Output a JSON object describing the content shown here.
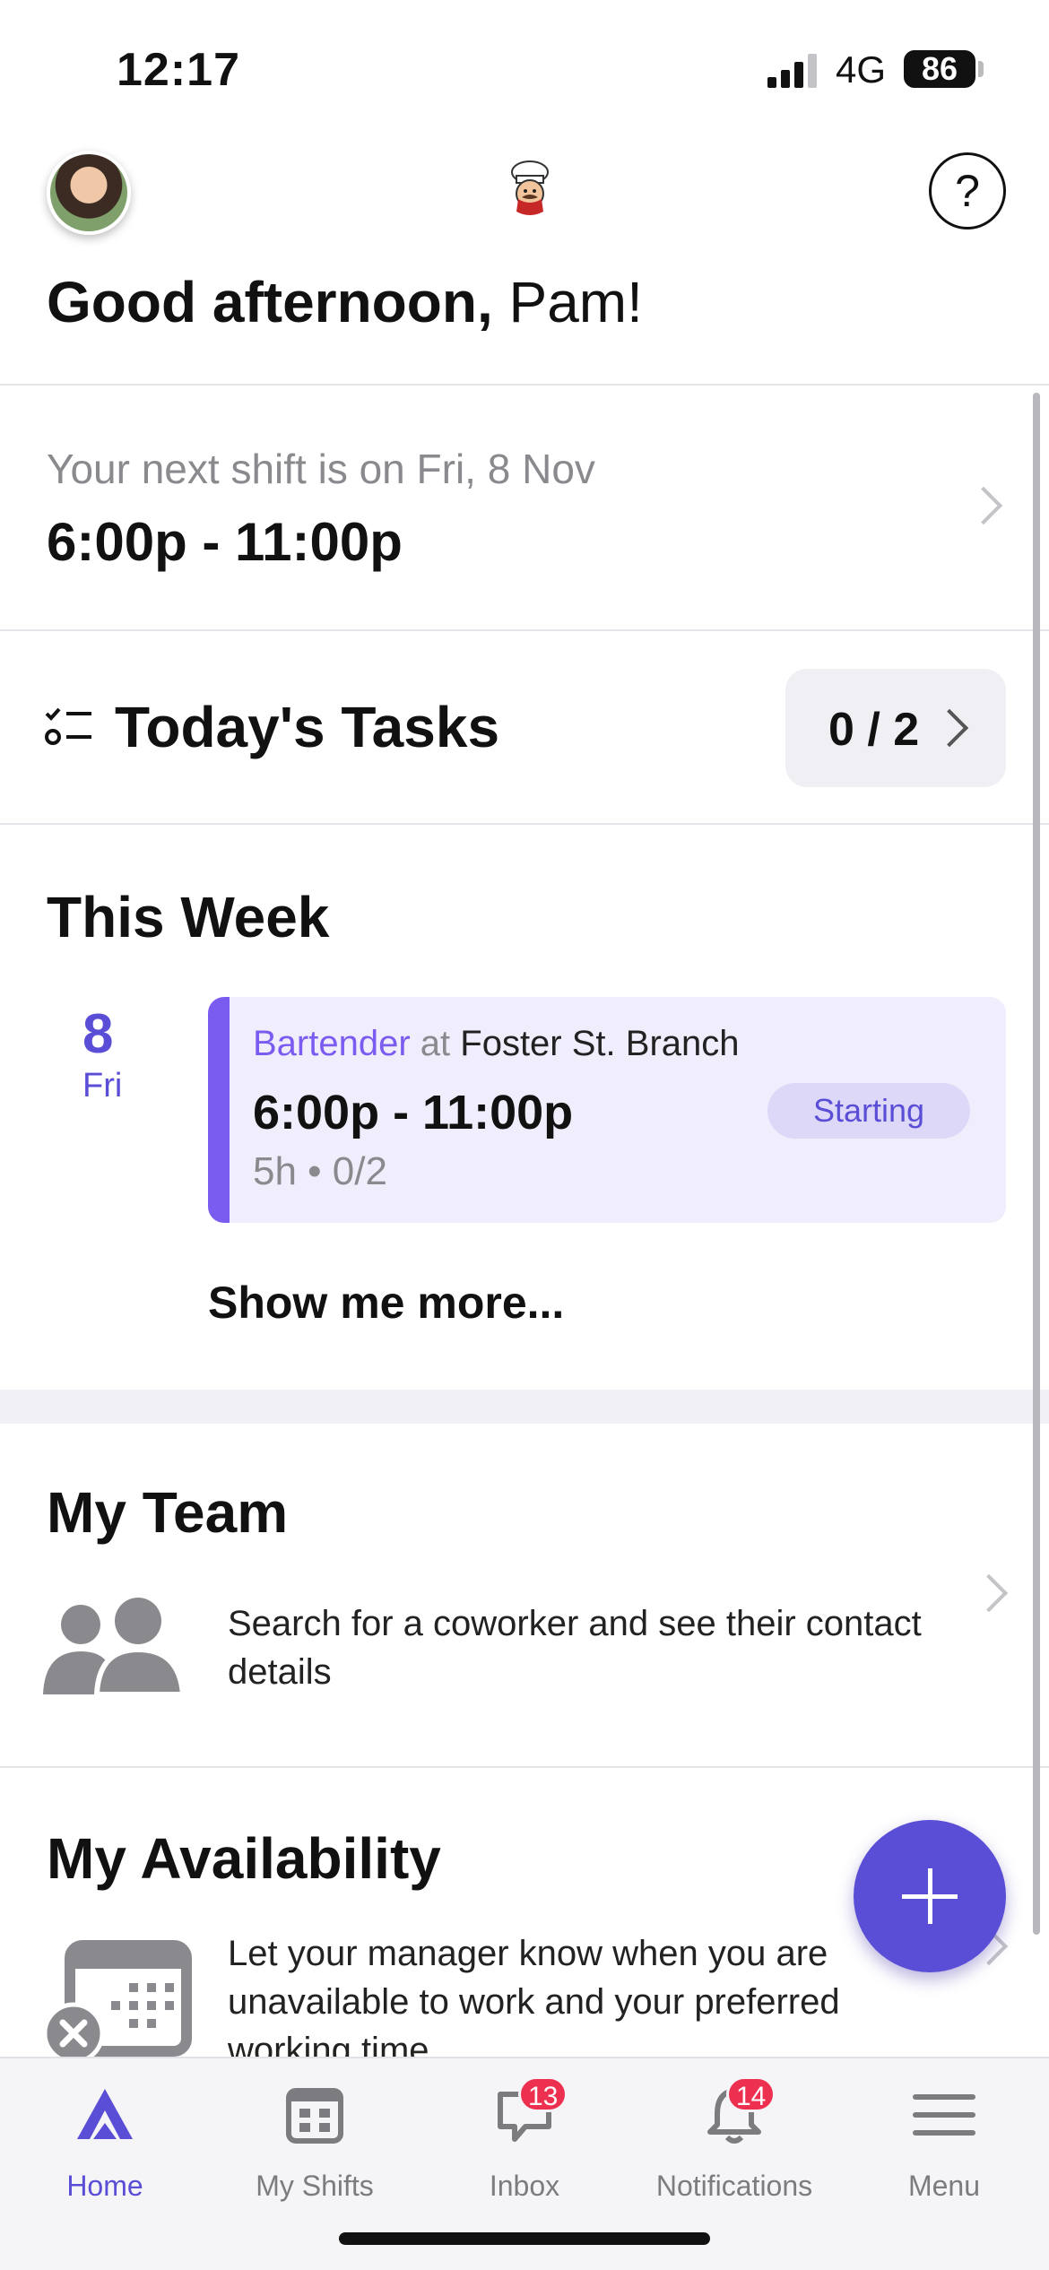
{
  "status_bar": {
    "time": "12:17",
    "network": "4G",
    "battery": "86"
  },
  "header": {
    "greeting_bold": "Good afternoon,",
    "greeting_name": " Pam!",
    "help_icon": "question-mark-icon",
    "logo_icon": "chef-logo-icon"
  },
  "next_shift": {
    "caption": "Your next shift is on Fri, 8 Nov",
    "time": "6:00p - 11:00p"
  },
  "tasks": {
    "title": "Today's Tasks",
    "count": "0 / 2"
  },
  "this_week": {
    "title": "This Week",
    "day_number": "8",
    "day_name": "Fri",
    "shift": {
      "role": "Bartender",
      "at": " at ",
      "location": "Foster St. Branch",
      "hours": "6:00p - 11:00p",
      "meta": "5h • 0/2",
      "status": "Starting"
    },
    "show_more": "Show me more..."
  },
  "my_team": {
    "title": "My Team",
    "description": "Search for a coworker and see their contact details"
  },
  "my_availability": {
    "title": "My Availability",
    "description": "Let your manager know when you are unavailable to work and your preferred working time"
  },
  "tabs": [
    {
      "label": "Home",
      "icon": "home-icon",
      "active": true
    },
    {
      "label": "My Shifts",
      "icon": "calendar-icon"
    },
    {
      "label": "Inbox",
      "icon": "chat-icon",
      "badge": "13"
    },
    {
      "label": "Notifications",
      "icon": "bell-icon",
      "badge": "14"
    },
    {
      "label": "Menu",
      "icon": "hamburger-icon"
    }
  ],
  "colors": {
    "accent": "#5b4ed6",
    "card_bg": "#f0edfc",
    "badge_red": "#ee3050"
  }
}
